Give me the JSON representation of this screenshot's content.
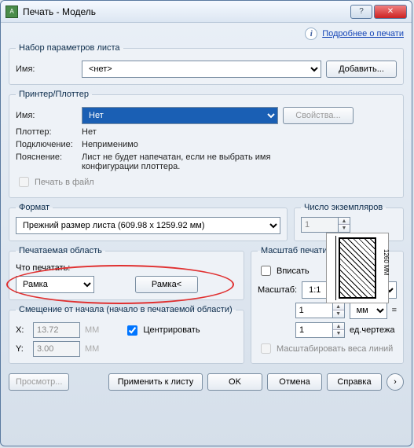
{
  "window": {
    "title": "Печать - Модель"
  },
  "info_link": "Подробнее о печати",
  "pageset": {
    "legend": "Набор параметров листа",
    "name_label": "Имя:",
    "name_value": "<нет>",
    "add_btn": "Добавить..."
  },
  "printer": {
    "legend": "Принтер/Плоттер",
    "name_label": "Имя:",
    "name_value": "Нет",
    "props_btn": "Свойства...",
    "plotter_label": "Плоттер:",
    "plotter_value": "Нет",
    "conn_label": "Подключение:",
    "conn_value": "Неприменимо",
    "desc_label": "Пояснение:",
    "desc_value": "Лист не будет напечатан, если не выбрать имя конфигурации плоттера.",
    "to_file": "Печать в файл",
    "preview_dim": "1260 MM"
  },
  "format": {
    "legend": "Формат",
    "value": "Прежний размер листа (609.98 x 1259.92 мм)"
  },
  "copies": {
    "legend": "Число экземпляров",
    "value": "1"
  },
  "area": {
    "legend": "Печатаемая область",
    "what_label": "Что печатать:",
    "what_value": "Рамка",
    "frame_btn": "Рамка<"
  },
  "scale": {
    "legend": "Масштаб печати",
    "fit": "Вписать",
    "scale_label": "Масштаб:",
    "scale_value": "1:1",
    "num1": "1",
    "unit1": "мм",
    "eq": "=",
    "num2": "1",
    "unit2": "ед.чертежа",
    "weights": "Масштабировать веса линий"
  },
  "offset": {
    "legend": "Смещение от начала (начало в печатаемой области)",
    "x_label": "X:",
    "x_value": "13.72",
    "y_label": "Y:",
    "y_value": "3.00",
    "unit": "MM",
    "center": "Центрировать"
  },
  "footer": {
    "preview": "Просмотр...",
    "apply": "Применить к листу",
    "ok": "OK",
    "cancel": "Отмена",
    "help": "Справка"
  }
}
